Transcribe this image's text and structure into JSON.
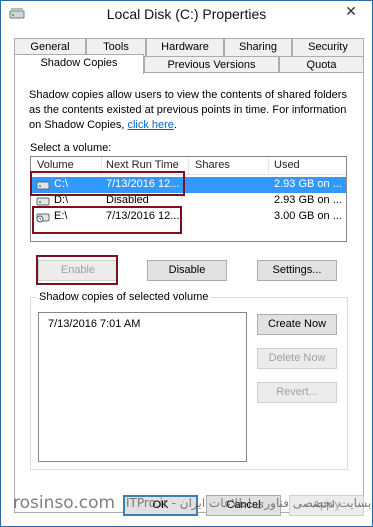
{
  "window": {
    "title": "Local Disk (C:) Properties",
    "close_glyph": "✕"
  },
  "tabs": {
    "row1": [
      "General",
      "Tools",
      "Hardware",
      "Sharing",
      "Security"
    ],
    "row2": [
      "Shadow Copies",
      "Previous Versions",
      "Quota"
    ],
    "active": "Shadow Copies"
  },
  "description": {
    "text": "Shadow copies allow users to view the contents of shared folders as the contents existed at previous points in time. For information on Shadow Copies, ",
    "link": "click here",
    "end": "."
  },
  "volumes": {
    "label": "Select a volume:",
    "columns": [
      "Volume",
      "Next Run Time",
      "Shares",
      "Used"
    ],
    "rows": [
      {
        "volume": "C:\\",
        "next_run": "7/13/2016 12...",
        "shares": "",
        "used": "2.93 GB on ...",
        "selected": true
      },
      {
        "volume": "D:\\",
        "next_run": "Disabled",
        "shares": "",
        "used": "2.93 GB on ...",
        "selected": false
      },
      {
        "volume": "E:\\",
        "next_run": "7/13/2016 12...",
        "shares": "",
        "used": "3.00 GB on ...",
        "selected": false
      }
    ]
  },
  "buttons": {
    "enable": "Enable",
    "disable": "Disable",
    "settings": "Settings...",
    "create_now": "Create Now",
    "delete_now": "Delete Now",
    "revert": "Revert...",
    "ok": "OK",
    "cancel": "Cancel",
    "apply": "Apply"
  },
  "snapshots": {
    "label": "Shadow copies of selected volume",
    "items": [
      "7/13/2016 7:01 AM"
    ]
  },
  "watermarks": {
    "left": "rosinso.com",
    "right": "ITPro.ir - وبسایت تخصصی فناوری اطلاعات ایران"
  },
  "colors": {
    "selection": "#3399ff",
    "annotation": "#7a1020",
    "link": "#0066cc"
  }
}
